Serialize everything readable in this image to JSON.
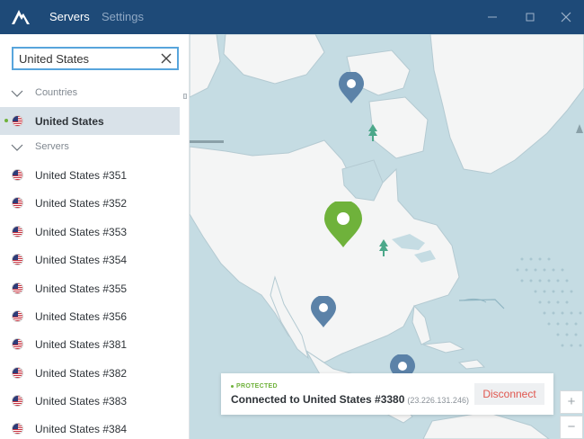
{
  "header": {
    "tabs": [
      {
        "label": "Servers",
        "active": true
      },
      {
        "label": "Settings",
        "active": false
      }
    ]
  },
  "search": {
    "value": "United States"
  },
  "sidebar": {
    "countries_label": "Countries",
    "selected_country": "United States",
    "servers_label": "Servers",
    "servers": [
      "United States #351",
      "United States #352",
      "United States #353",
      "United States #354",
      "United States #355",
      "United States #356",
      "United States #381",
      "United States #382",
      "United States #383",
      "United States #384"
    ]
  },
  "connection": {
    "status": "PROTECTED",
    "text": "Connected to United States #3380",
    "ip": "(23.226.131.246)",
    "disconnect_label": "Disconnect"
  },
  "zoom": {
    "in_label": "+",
    "out_label": "−"
  },
  "colors": {
    "titlebar": "#1e4a78",
    "accent_green": "#6fb23b",
    "pin_blue": "#5b82a8",
    "disconnect_red": "#e0574f",
    "sea": "#c5dce3",
    "land": "#f4f5f5"
  }
}
